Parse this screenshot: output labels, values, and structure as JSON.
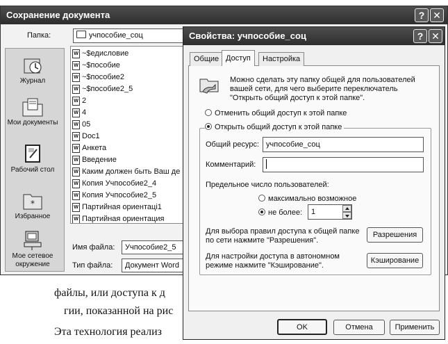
{
  "save_dialog": {
    "title": "Сохранение документа",
    "folder_label": "Папка:",
    "folder_value": "учпособие_соц",
    "places": [
      {
        "label": "Журнал"
      },
      {
        "label": "Мои документы"
      },
      {
        "label": "Рабочий стол"
      },
      {
        "label": "Избранное"
      },
      {
        "label": "Мое сетевое окружение"
      }
    ],
    "files": [
      "~$едисловие",
      "~$пособие",
      "~$пособие2",
      "~$пособие2_5",
      "2",
      "4",
      "05",
      "Doc1",
      "Анкета",
      "Введение",
      "Каким должен быть Ваш де",
      "Копия Учпособие2_4",
      "Копия Учпособие2_5",
      "Партийная ориентаці1",
      "Партийная ориентация"
    ],
    "filename_label": "Имя файла:",
    "filename_value": "Учпособие2_5",
    "filetype_label": "Тип файла:",
    "filetype_value": "Документ Word"
  },
  "props_dialog": {
    "title": "Свойства: учпособие_соц",
    "tabs": [
      "Общие",
      "Доступ",
      "Настройка"
    ],
    "description": "Можно сделать эту папку общей для пользователей вашей сети, для чего выберите переключатель \"Открыть общий доступ к этой папке\".",
    "radio_unshare": "Отменить общий доступ к этой папке",
    "radio_share": "Открыть общий доступ к этой папке",
    "share_name_label": "Общий ресурс:",
    "share_name_value": "учпособие_соц",
    "comment_label": "Комментарий:",
    "comment_value": "",
    "user_limit_label": "Предельное число пользователей:",
    "radio_max": "максимально возможное",
    "radio_no_more": "не более:",
    "no_more_value": "1",
    "permissions_text": "Для выбора правил доступа к общей папке по сети нажмите \"Разрешения\".",
    "permissions_button": "Разрешения",
    "caching_text": "Для настройки доступа в автономном режиме нажмите \"Кэширование\".",
    "caching_button": "Кэширование",
    "ok_button": "OK",
    "cancel_button": "Отмена",
    "apply_button": "Применить",
    "help_glyph": "?",
    "close_glyph": "✕"
  },
  "background_document": {
    "line1": "файлы, или доступа к д",
    "line2": "гии, показанной на рис",
    "line3": "Эта технология реализ"
  }
}
